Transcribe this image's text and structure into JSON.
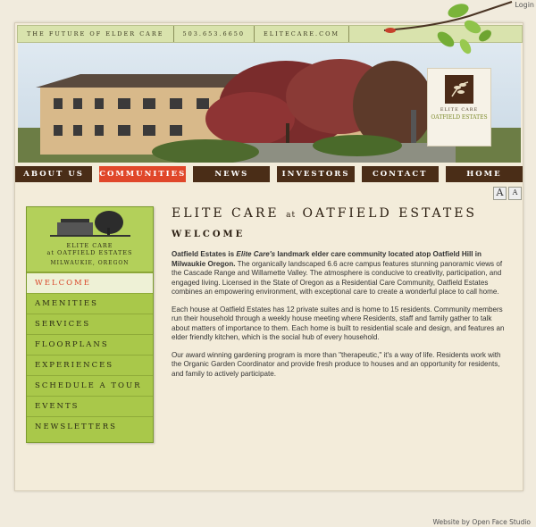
{
  "login": "Login",
  "topbar": {
    "tagline": "THE FUTURE OF ELDER CARE",
    "phone": "503.653.6650",
    "site": "ELITECARE.COM"
  },
  "logo": {
    "line1": "ELITE CARE",
    "line2": "OATFIELD ESTATES"
  },
  "nav": [
    "ABOUT US",
    "COMMUNITIES",
    "NEWS",
    "INVESTORS",
    "CONTACT",
    "HOME"
  ],
  "nav_active": 1,
  "sidebar": {
    "name1": "ELITE CARE",
    "name2": "at OATFIELD ESTATES",
    "location": "MILWAUKIE, OREGON",
    "items": [
      "WELCOME",
      "AMENITIES",
      "SERVICES",
      "FLOORPLANS",
      "EXPERIENCES",
      "SCHEDULE A TOUR",
      "EVENTS",
      "NEWSLETTERS"
    ]
  },
  "content": {
    "title_a": "ELITE CARE",
    "title_at": "at",
    "title_b": "OATFIELD ESTATES",
    "heading": "WELCOME",
    "p1_bold": "Oatfield Estates is ",
    "p1_italic": "Elite Care's",
    "p1_bold2": " landmark elder care community located atop Oatfield Hill in Milwaukie Oregon.",
    "p1_rest": " The organically landscaped 6.6 acre campus features stunning panoramic views of the Cascade Range and Willamette Valley. The atmosphere is conducive to creativity, participation, and engaged living. Licensed in the State of Oregon as a Residential Care Community, Oatfield Estates combines an empowering environment, with exceptional care to create a wonderful place to call home.",
    "p2": "Each house at Oatfield Estates has 12 private suites and is home to 15 residents. Community members run their household through a weekly house meeting where Residents, staff and family gather to talk about matters of importance to them. Each home is built to residential scale and design, and features an elder friendly kitchen, which is the social hub of every household.",
    "p3": "Our award winning gardening program is more than \"therapeutic,\" it's a way of life. Residents work with the Organic Garden Coordinator and provide fresh produce to houses and an opportunity for residents, and family to actively participate."
  },
  "font_buttons": [
    "A",
    "A"
  ],
  "footer": "Website by Open Face Studio"
}
